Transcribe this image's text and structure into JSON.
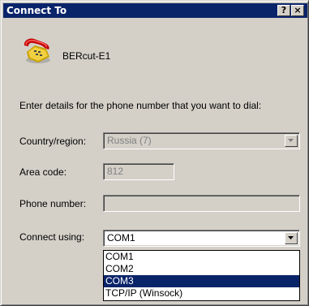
{
  "window": {
    "title": "Connect To",
    "help_label": "?",
    "close_label": "×"
  },
  "connection": {
    "name": "BERcut-E1"
  },
  "instructions": "Enter details for the phone number that you want to dial:",
  "form": {
    "country_label": "Country/region:",
    "country_value": "Russia (7)",
    "area_code_label": "Area code:",
    "area_code_value": "812",
    "phone_label": "Phone number:",
    "phone_value": "",
    "connect_using_label": "Connect using:",
    "connect_using_value": "COM1"
  },
  "dropdown": {
    "options": [
      "COM1",
      "COM2",
      "COM3",
      "TCP/IP (Winsock)"
    ],
    "highlighted": "COM3"
  },
  "icons": {
    "app": "phone-icon",
    "dropdown": "chevron-down-icon",
    "help": "help-icon",
    "close": "close-icon"
  },
  "colors": {
    "titlebar": "#0a246a",
    "face": "#d4d0c8",
    "highlight": "#0a246a"
  }
}
